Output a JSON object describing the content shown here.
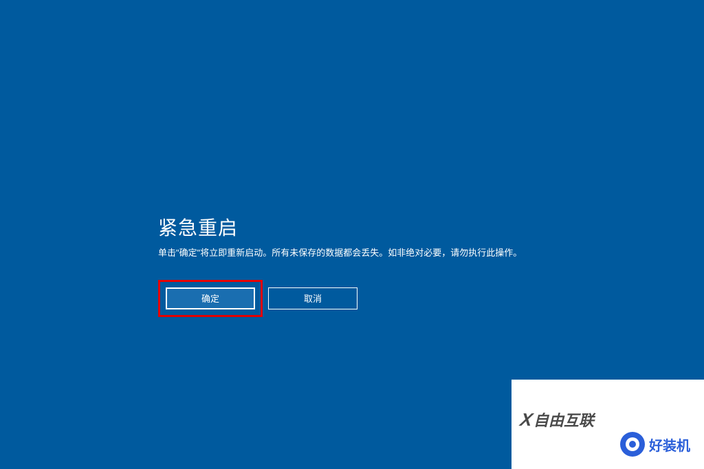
{
  "dialog": {
    "title": "紧急重启",
    "message": "单击\"确定\"将立即重新启动。所有未保存的数据都会丢失。如非绝对必要，请勿执行此操作。",
    "ok_label": "确定",
    "cancel_label": "取消"
  },
  "watermarks": {
    "brand1": "自由互联",
    "brand2": "好装机"
  },
  "colors": {
    "background": "#005a9e",
    "highlight": "#e60000",
    "button_primary": "#1a6eb0",
    "text": "#ffffff"
  }
}
